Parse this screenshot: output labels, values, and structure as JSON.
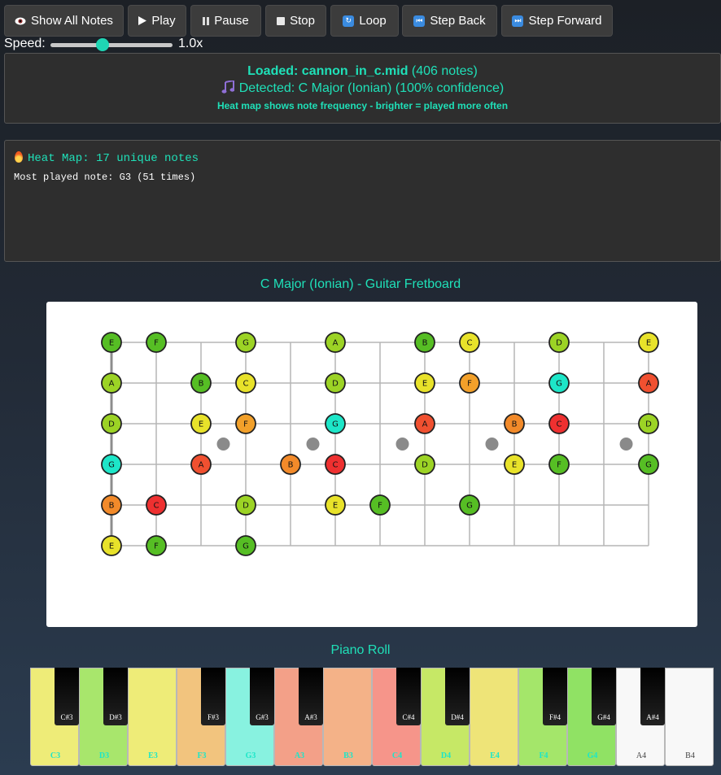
{
  "toolbar": {
    "show_all": "Show All Notes",
    "play": "Play",
    "pause": "Pause",
    "stop": "Stop",
    "loop": "Loop",
    "step_back": "Step Back",
    "step_forward": "Step Forward"
  },
  "speed": {
    "label": "Speed:",
    "value_text": "1.0x",
    "value": 1.0,
    "min": 0.25,
    "max": 2.0
  },
  "info": {
    "loaded_prefix": "Loaded: cannon_in_c.mid",
    "loaded_count": " (406 notes)",
    "detected": "Detected: C Major (Ionian) (100% confidence)",
    "heat_desc": "Heat map shows note frequency - brighter = played more often"
  },
  "heatmap": {
    "title": "Heat Map: 17 unique notes",
    "most_played": "Most played note: G3 (51 times)"
  },
  "fretboard": {
    "title": "C Major (Ionian) - Guitar Fretboard",
    "strings": [
      {
        "notes": [
          "E",
          "F",
          "",
          "G",
          "",
          "A",
          "",
          "B",
          "C",
          "",
          "D",
          "",
          "E"
        ],
        "colors": [
          "#56be24",
          "#56be24",
          "",
          "#9cd325",
          "",
          "#9cd325",
          "",
          "#56be24",
          "#e8e22a",
          "",
          "#9cd325",
          "",
          "#e8e22a"
        ]
      },
      {
        "notes": [
          "A",
          "",
          "B",
          "C",
          "",
          "D",
          "",
          "E",
          "F",
          "",
          "G",
          "",
          "A"
        ],
        "colors": [
          "#9cd325",
          "",
          "#56be24",
          "#e8e22a",
          "",
          "#9cd325",
          "",
          "#e8e22a",
          "#f2a02a",
          "",
          "#1de6c8",
          "",
          "#f05030"
        ]
      },
      {
        "notes": [
          "D",
          "",
          "E",
          "F",
          "",
          "G",
          "",
          "A",
          "",
          "B",
          "C",
          "",
          "D"
        ],
        "colors": [
          "#9cd325",
          "",
          "#e8e22a",
          "#f2a02a",
          "",
          "#1de6c8",
          "",
          "#f05030",
          "",
          "#f28a2a",
          "#ee3030",
          "",
          "#9cd325"
        ]
      },
      {
        "notes": [
          "G",
          "",
          "A",
          "",
          "B",
          "C",
          "",
          "D",
          "",
          "E",
          "F",
          "",
          "G"
        ],
        "colors": [
          "#1de6c8",
          "",
          "#f05030",
          "",
          "#f28a2a",
          "#ee3030",
          "",
          "#9cd325",
          "",
          "#e8e22a",
          "#56be24",
          "",
          "#56be24"
        ]
      },
      {
        "notes": [
          "B",
          "C",
          "",
          "D",
          "",
          "E",
          "F",
          "",
          "G"
        ],
        "colors": [
          "#f28a2a",
          "#ee3030",
          "",
          "#9cd325",
          "",
          "#e8e22a",
          "#56be24",
          "",
          "#56be24"
        ]
      },
      {
        "notes": [
          "E",
          "F",
          "",
          "G"
        ],
        "colors": [
          "#e8e22a",
          "#56be24",
          "",
          "#56be24"
        ]
      }
    ],
    "inlay_frets": [
      3,
      5,
      7,
      9,
      12
    ]
  },
  "piano": {
    "title": "Piano Roll",
    "white_keys": [
      {
        "label": "C3",
        "color": "#eeec78",
        "text_color": "#1de6c8"
      },
      {
        "label": "D3",
        "color": "#a8e66c",
        "text_color": "#1de6c8"
      },
      {
        "label": "E3",
        "color": "#eeec78",
        "text_color": "#1de6c8"
      },
      {
        "label": "F3",
        "color": "#f2c47e",
        "text_color": "#1de6c8"
      },
      {
        "label": "G3",
        "color": "#88f2e0",
        "text_color": "#1de6c8"
      },
      {
        "label": "A3",
        "color": "#f3a088",
        "text_color": "#1de6c8"
      },
      {
        "label": "B3",
        "color": "#f4b288",
        "text_color": "#1de6c8"
      },
      {
        "label": "C4",
        "color": "#f6958a",
        "text_color": "#1de6c8"
      },
      {
        "label": "D4",
        "color": "#c6e866",
        "text_color": "#1de6c8"
      },
      {
        "label": "E4",
        "color": "#eee478",
        "text_color": "#1de6c8"
      },
      {
        "label": "F4",
        "color": "#a4e66a",
        "text_color": "#1de6c8"
      },
      {
        "label": "G4",
        "color": "#90e264",
        "text_color": "#1de6c8"
      },
      {
        "label": "A4",
        "color": "#f8f8f8",
        "text_color": "#444444"
      },
      {
        "label": "B4",
        "color": "#f8f8f8",
        "text_color": "#444444"
      }
    ],
    "black_keys": [
      {
        "label": "C#3",
        "after": 0
      },
      {
        "label": "D#3",
        "after": 1
      },
      {
        "label": "F#3",
        "after": 3
      },
      {
        "label": "G#3",
        "after": 4
      },
      {
        "label": "A#3",
        "after": 5
      },
      {
        "label": "C#4",
        "after": 7
      },
      {
        "label": "D#4",
        "after": 8
      },
      {
        "label": "F#4",
        "after": 10
      },
      {
        "label": "G#4",
        "after": 11
      },
      {
        "label": "A#4",
        "after": 12
      }
    ]
  }
}
